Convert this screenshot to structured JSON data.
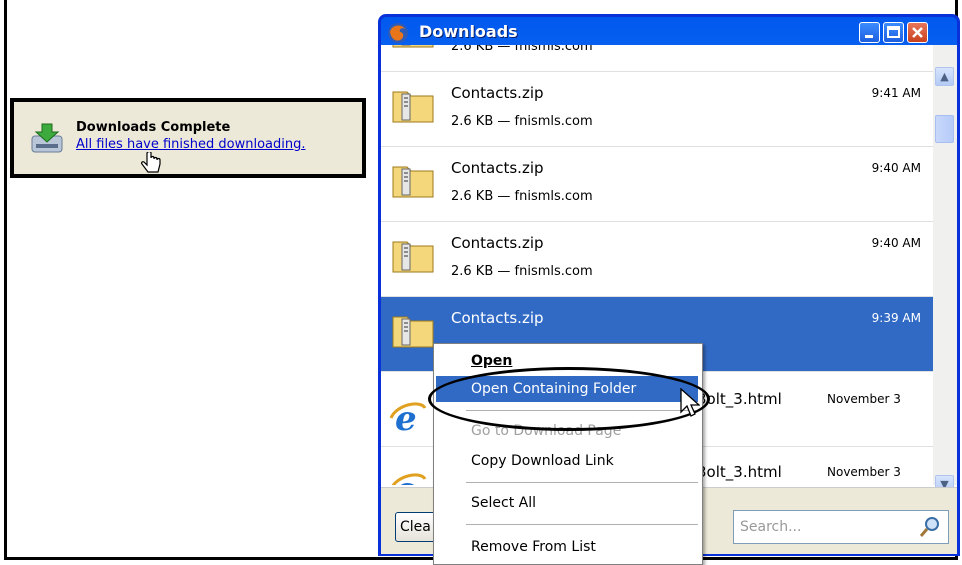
{
  "notification": {
    "title": "Downloads Complete",
    "link": "All files have finished downloading."
  },
  "window": {
    "title": "Downloads"
  },
  "downloads": [
    {
      "name": "",
      "meta": "2.6 KB — fnismls.com",
      "time": ""
    },
    {
      "name": "Contacts.zip",
      "meta": "2.6 KB — fnismls.com",
      "time": "9:41 AM"
    },
    {
      "name": "Contacts.zip",
      "meta": "2.6 KB — fnismls.com",
      "time": "9:40 AM"
    },
    {
      "name": "Contacts.zip",
      "meta": "2.6 KB — fnismls.com",
      "time": "9:40 AM"
    },
    {
      "name": "Contacts.zip",
      "meta": "",
      "time": "9:39 AM"
    },
    {
      "name": "3olt_3.html",
      "meta": "",
      "time": "November 3"
    },
    {
      "name": "3olt_3.html",
      "meta": "",
      "time": "November 3"
    }
  ],
  "bottom": {
    "clear_label": "Clea",
    "search_placeholder": "Search..."
  },
  "context_menu": {
    "open": "Open",
    "open_folder": "Open Containing Folder",
    "go_to_page": "Go to Download Page",
    "copy_link": "Copy Download Link",
    "select_all": "Select All",
    "remove": "Remove From List"
  }
}
